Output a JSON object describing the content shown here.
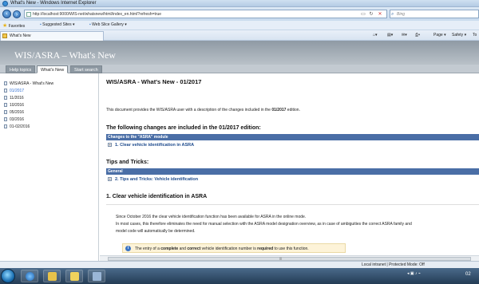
{
  "window": {
    "title": "What's New - Windows Internet Explorer"
  },
  "address_bar": {
    "url": "http://localhost:9000/WIS-net/whatsnew/html/index_en.html?refresh=true",
    "search_placeholder": "Bing"
  },
  "favorites_bar": {
    "favorites_label": "Favorites",
    "suggested_sites_label": "Suggested Sites ▾",
    "web_slice_label": "Web Slice Gallery ▾"
  },
  "browser_tab": {
    "label": "What's New"
  },
  "command_bar": {
    "page_label": "Page ▾",
    "safety_label": "Safety ▾",
    "tools_label": "To"
  },
  "site": {
    "banner_title": "WIS/ASRA – What's New",
    "tabs": [
      {
        "label": "Help topics",
        "active": false
      },
      {
        "label": "What's New",
        "active": true
      },
      {
        "label": "Start search",
        "active": false
      }
    ]
  },
  "sidebar": {
    "items": [
      {
        "label": "WIS/ASRA - What's New",
        "selected": false
      },
      {
        "label": "01/2017",
        "selected": true
      },
      {
        "label": "11/2016",
        "selected": false
      },
      {
        "label": "10/2016",
        "selected": false
      },
      {
        "label": "05/2016",
        "selected": false
      },
      {
        "label": "03/2016",
        "selected": false
      },
      {
        "label": "01-02/2016",
        "selected": false
      }
    ]
  },
  "content": {
    "heading": "WIS/ASRA - What's New - 01/2017",
    "intro_prefix": "This document provides the WIS/ASRA user with a description of the changes included in the ",
    "intro_bold": "01/2017",
    "intro_suffix": " edition.",
    "changes_heading": "The following changes are included in the 01/2017 edition:",
    "changes_bar": "Changes to the \"ASRA\" module",
    "changes_link": "1. Clear vehicle identification in ASRA",
    "tips_heading": "Tips and Tricks:",
    "tips_bar": "General",
    "tips_link": "2. Tips and Tricks: Vehicle identification",
    "section1_heading": "1.  Clear vehicle identification in ASRA",
    "para1": "Since October 2016 the clear vehicle identification function has been available for ASRA in the online mode.",
    "para2": "In most cases, this therefore eliminates the need for manual selection with the ASRA model designation overview, as in case of ambiguities the correct ASRA family and",
    "para3": "model code will automatically be determined.",
    "note_p1": "The entry of a ",
    "note_b1": "complete",
    "note_p2": " and ",
    "note_b2": "correct",
    "note_p3": " vehicle identification number is ",
    "note_b3": "required",
    "note_p4": " to use this function."
  },
  "status_bar": {
    "zone": "Local intranet | Protected Mode: Off"
  },
  "taskbar": {
    "clock": "02"
  },
  "colors": {
    "section_bar": "#4a6ea6",
    "link": "#1d4a8c",
    "selected_sidebar": "#2a6bd1",
    "banner": "#9aa5ae"
  }
}
